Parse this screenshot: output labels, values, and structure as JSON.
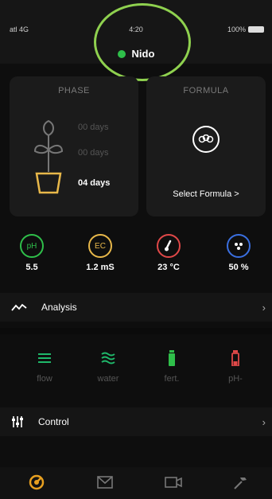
{
  "status": {
    "signal": "atl 4G",
    "time": "4:20",
    "battery": "100%"
  },
  "header": {
    "device_name": "Nido",
    "online_color": "#2fbf4a"
  },
  "phase": {
    "title": "PHASE",
    "stages": [
      "00 days",
      "00 days",
      "04 days"
    ]
  },
  "formula": {
    "title": "FORMULA",
    "link": "Select Formula >"
  },
  "sensors": [
    {
      "icon": "ph-icon",
      "label": "pH",
      "value": "5.5",
      "color": "#2fbf4a"
    },
    {
      "icon": "ec-icon",
      "label": "EC",
      "value": "1.2 mS",
      "color": "#e8b84a"
    },
    {
      "icon": "thermometer-icon",
      "label": "",
      "value": "23 °C",
      "color": "#e04848"
    },
    {
      "icon": "humidity-icon",
      "label": "",
      "value": "50 %",
      "color": "#3a6fe0"
    }
  ],
  "analysis": {
    "label": "Analysis"
  },
  "actions": [
    {
      "icon": "flow-icon",
      "label": "flow",
      "color": "#1fb86a"
    },
    {
      "icon": "water-icon",
      "label": "water",
      "color": "#1fb86a"
    },
    {
      "icon": "fert-icon",
      "label": "fert.",
      "color": "#2fbf4a"
    },
    {
      "icon": "ph-minus-icon",
      "label": "pH-",
      "color": "#e04848"
    }
  ],
  "control": {
    "label": "Control"
  },
  "tabs": [
    "home-tab",
    "messages-tab",
    "camera-tab",
    "tools-tab"
  ]
}
